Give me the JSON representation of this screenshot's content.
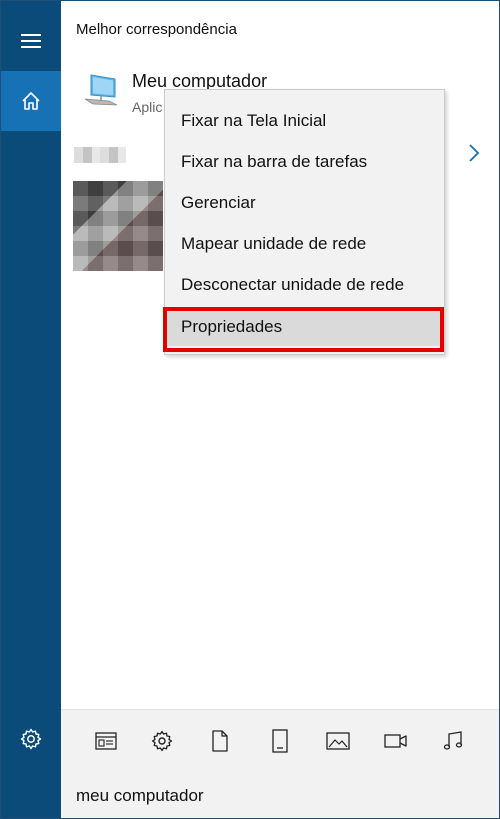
{
  "panel": {
    "section_title": "Melhor correspondência"
  },
  "best_match": {
    "name": "Meu computador",
    "subtitle": "Aplic",
    "icon": "computer-icon"
  },
  "context_menu": {
    "items": [
      {
        "label": "Fixar na Tela Inicial"
      },
      {
        "label": "Fixar na barra de tarefas"
      },
      {
        "label": "Gerenciar"
      },
      {
        "label": "Mapear unidade de rede"
      },
      {
        "label": "Desconectar unidade de rede"
      },
      {
        "label": "Propriedades",
        "highlighted": true
      }
    ]
  },
  "rail": {
    "icons": [
      "hamburger-menu-icon",
      "home-icon",
      "gear-icon"
    ]
  },
  "filters": {
    "icons": [
      "apps-icon",
      "settings-icon",
      "document-icon",
      "tablet-icon",
      "photo-icon",
      "video-icon",
      "music-icon"
    ]
  },
  "search": {
    "value": "meu computador"
  },
  "colors": {
    "rail": "#0b4b7a",
    "rail_active": "#1672b4",
    "highlight": "#e30000",
    "accent": "#1672b4"
  }
}
